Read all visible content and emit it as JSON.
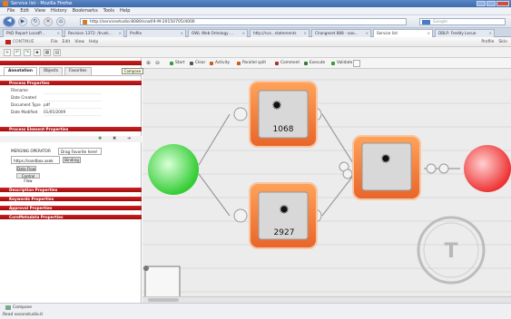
{
  "window": {
    "title": "Service list - Mozilla Firefox"
  },
  "menubar": [
    "File",
    "Edit",
    "View",
    "History",
    "Bookmarks",
    "Tools",
    "Help"
  ],
  "nav": {
    "url": "http://servicestudio:8080/scwf/4-M-20150705/4000",
    "search_placeholder": "Google"
  },
  "tabs": [
    {
      "label": "PhD Report LocatP..."
    },
    {
      "label": "Revision 1372: /trunk..."
    },
    {
      "label": "Profile"
    },
    {
      "label": "OWL Web Ontology ..."
    },
    {
      "label": "http://cvs...statements"
    },
    {
      "label": "Changeset 888 - ooo..."
    },
    {
      "label": "Service list"
    },
    {
      "label": "DBLP: Freddy Lecue"
    }
  ],
  "app": {
    "logo": "CONTINUE",
    "menu": [
      "File",
      "Edit",
      "View",
      "Help"
    ],
    "right": [
      "Profile",
      "Skin"
    ]
  },
  "left": {
    "tabs": [
      "Annotation",
      "Objects",
      "Favorites"
    ],
    "tooltip": "Compose",
    "sections": {
      "process_properties": "Process Properties",
      "process_element": "Process Element Properties",
      "description": "Description Properties",
      "keywords": "Keywords Properties",
      "approval": "Approval Properties",
      "core_metadata": "CoreMetadata Properties"
    },
    "props": [
      {
        "k": "Filename",
        "v": ""
      },
      {
        "k": "Date Created",
        "v": ""
      },
      {
        "k": "Document Type",
        "v": "pdf"
      },
      {
        "k": "Date Modified",
        "v": "01/05/2009"
      }
    ],
    "merge_label": "MERGING OPERATOR",
    "merge_value": "Drag Favorite here!",
    "url_value": "https://sandbox.asek",
    "url_button": "Binding",
    "btn_dataflow": "Data Flow",
    "btn_controlflow": "Control Flow"
  },
  "canvas": {
    "tools": [
      {
        "label": "Start",
        "color": "#3a9a3a"
      },
      {
        "label": "Clear",
        "color": "#555555"
      },
      {
        "label": "Activity",
        "color": "#cc5a1a"
      },
      {
        "label": "Parallel split",
        "color": "#cc5a1a"
      },
      {
        "label": "Comment",
        "color": "#aa3333"
      },
      {
        "label": "Execute",
        "color": "#3a7a3a"
      },
      {
        "label": "Validate",
        "color": "#3a9a3a"
      }
    ],
    "node1_value": "1068",
    "node2_value": "2927",
    "start_color": "#33cc33",
    "end_color": "#ee3333",
    "accent": "#f07a3a"
  },
  "status": {
    "item": "Compose",
    "text": "Read soconstudio.it"
  }
}
